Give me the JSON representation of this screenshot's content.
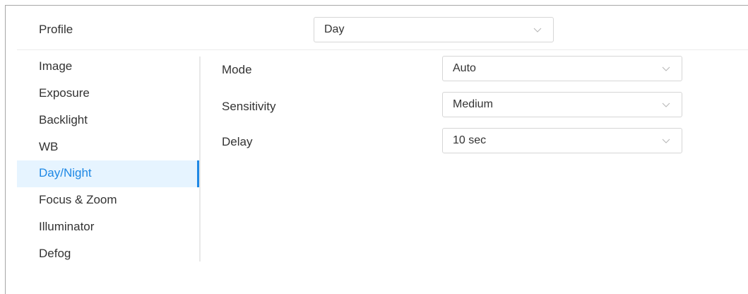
{
  "profile": {
    "label": "Profile",
    "value": "Day"
  },
  "menu": {
    "items": [
      {
        "label": "Image"
      },
      {
        "label": "Exposure"
      },
      {
        "label": "Backlight"
      },
      {
        "label": "WB"
      },
      {
        "label": "Day/Night"
      },
      {
        "label": "Focus & Zoom"
      },
      {
        "label": "Illuminator"
      },
      {
        "label": "Defog"
      }
    ],
    "active": "Day/Night"
  },
  "form": {
    "mode": {
      "label": "Mode",
      "value": "Auto"
    },
    "sensitivity": {
      "label": "Sensitivity",
      "value": "Medium"
    },
    "delay": {
      "label": "Delay",
      "value": "10 sec"
    }
  },
  "colors": {
    "accent": "#1e88e5",
    "active_bg": "#e6f4ff",
    "border": "#d6d6d6"
  },
  "icons": {
    "dropdown": "chevron-down-icon"
  }
}
